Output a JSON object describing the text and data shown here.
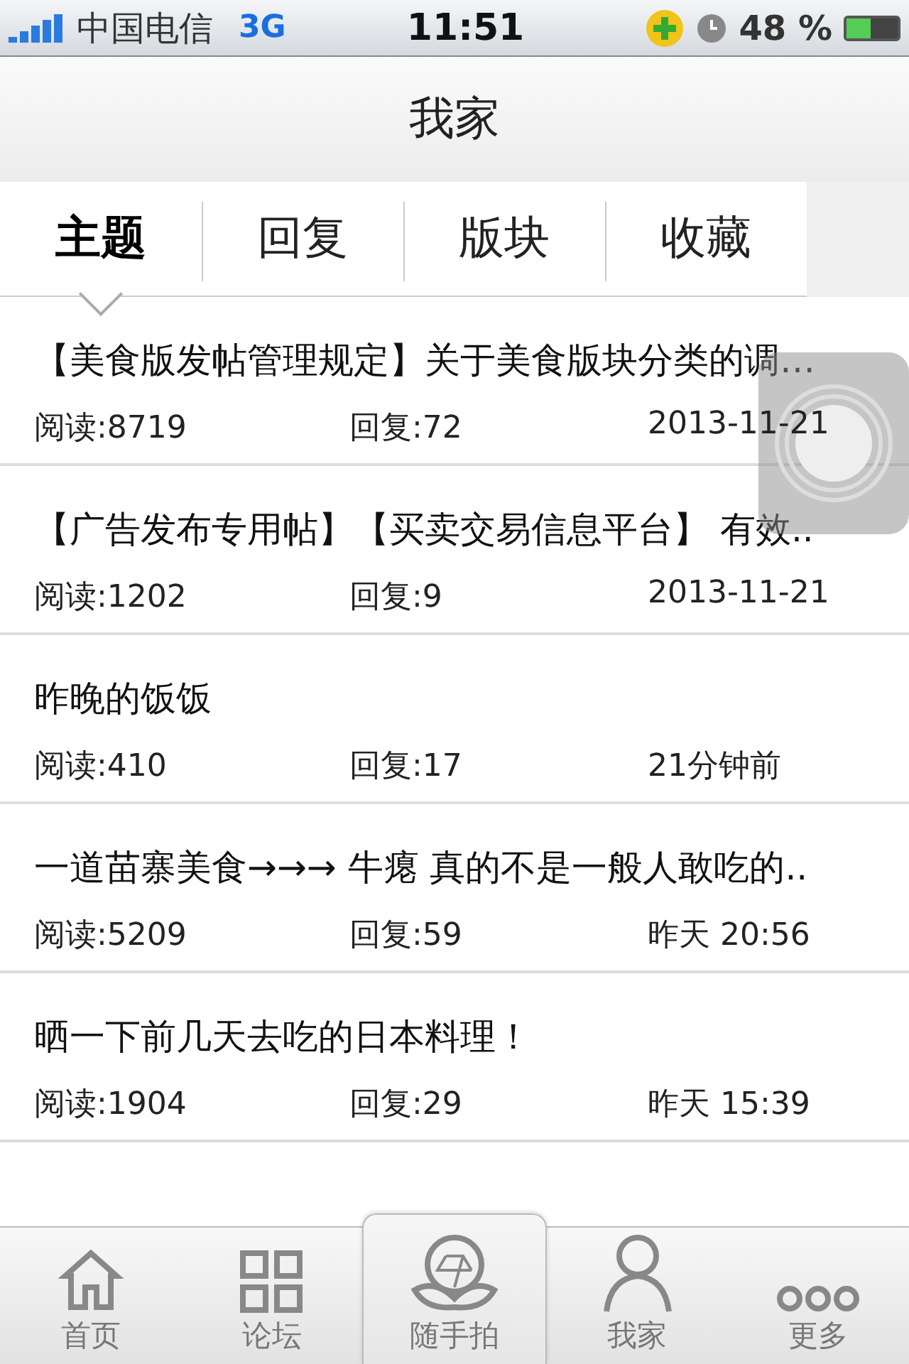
{
  "status_bar": {
    "carrier": "中国电信",
    "network": "3G",
    "time": "11:51",
    "battery": "48 %"
  },
  "nav_bar": {
    "title": "我家"
  },
  "tabs": [
    {
      "label": "主题",
      "selected": true
    },
    {
      "label": "回复",
      "selected": false
    },
    {
      "label": "版块",
      "selected": false
    },
    {
      "label": "收藏",
      "selected": false
    }
  ],
  "posts": [
    {
      "title": "【美食版发帖管理规定】关于美食版块分类的调…",
      "reads": "阅读:8719",
      "replies": "回复:72",
      "time": "2013-11-21"
    },
    {
      "title": "【广告发布专用帖】【买卖交易信息平台】 有效..",
      "reads": "阅读:1202",
      "replies": "回复:9",
      "time": "2013-11-21"
    },
    {
      "title": "昨晚的饭饭",
      "reads": "阅读:410",
      "replies": "回复:17",
      "time": "21分钟前"
    },
    {
      "title": "一道苗寨美食→→→ 牛瘪 真的不是一般人敢吃的..",
      "reads": "阅读:5209",
      "replies": "回复:59",
      "time": "昨天 20:56"
    },
    {
      "title": "晒一下前几天去吃的日本料理！",
      "reads": "阅读:1904",
      "replies": "回复:29",
      "time": "昨天 15:39"
    }
  ],
  "tab_bar": [
    {
      "label": "首页",
      "kind": "home"
    },
    {
      "label": "论坛",
      "kind": "grid"
    },
    {
      "label": "随手拍",
      "kind": "camera"
    },
    {
      "label": "我家",
      "kind": "person"
    },
    {
      "label": "更多",
      "kind": "more"
    }
  ]
}
